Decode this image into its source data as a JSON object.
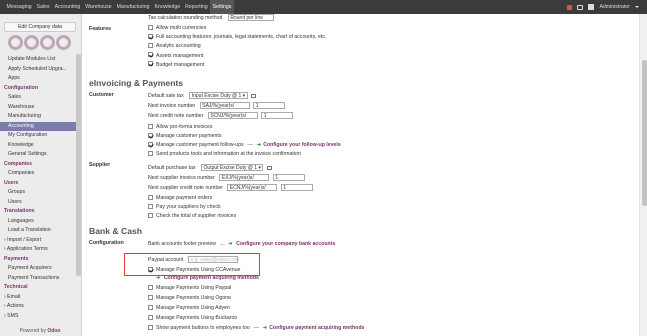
{
  "topbar": {
    "menu": [
      "Messaging",
      "Sales",
      "Accounting",
      "Warehouse",
      "Manufacturing",
      "Knowledge",
      "Reporting",
      "Settings"
    ],
    "active": "Settings",
    "user": "Administrator"
  },
  "sidebar": {
    "edit_company": "Edit Company data",
    "items": [
      {
        "label": "Update Modules List",
        "type": "item"
      },
      {
        "label": "Apply Scheduled Upgra...",
        "type": "item"
      },
      {
        "label": "Apps",
        "type": "item"
      },
      {
        "label": "Configuration",
        "type": "head"
      },
      {
        "label": "Sales",
        "type": "item"
      },
      {
        "label": "Warehouse",
        "type": "item"
      },
      {
        "label": "Manufacturing",
        "type": "item"
      },
      {
        "label": "Accounting",
        "type": "item",
        "active": true
      },
      {
        "label": "My Configuration",
        "type": "item"
      },
      {
        "label": "Knowledge",
        "type": "item"
      },
      {
        "label": "General Settings",
        "type": "item"
      },
      {
        "label": "Companies",
        "type": "head"
      },
      {
        "label": "Companies",
        "type": "item"
      },
      {
        "label": "Users",
        "type": "head"
      },
      {
        "label": "Groups",
        "type": "item"
      },
      {
        "label": "Users",
        "type": "item"
      },
      {
        "label": "Translations",
        "type": "head"
      },
      {
        "label": "Languages",
        "type": "item"
      },
      {
        "label": "Load a Translation",
        "type": "item"
      },
      {
        "label": "› Import / Export",
        "type": "sub"
      },
      {
        "label": "› Application Terms",
        "type": "sub"
      },
      {
        "label": "Payments",
        "type": "head"
      },
      {
        "label": "Payment Acquirers",
        "type": "item"
      },
      {
        "label": "Payment Transactions",
        "type": "item"
      },
      {
        "label": "Technical",
        "type": "head"
      },
      {
        "label": "› Email",
        "type": "sub"
      },
      {
        "label": "› Actions",
        "type": "sub"
      },
      {
        "label": "› SMS",
        "type": "sub"
      }
    ],
    "footer_prefix": "Powered by ",
    "footer_brand": "Odoo"
  },
  "main": {
    "rounding_label": "Tax calculation rounding method",
    "rounding_value": "Round per line",
    "features_label": "Features",
    "features": [
      {
        "label": "Allow multi currencies",
        "checked": false
      },
      {
        "label": "Full accounting features: journals, legal statements, chart of accounts, etc.",
        "checked": true
      },
      {
        "label": "Analytic accounting",
        "checked": false
      },
      {
        "label": "Assets management",
        "checked": true
      },
      {
        "label": "Budget management",
        "checked": true
      }
    ],
    "einvoicing_title": "eInvoicing & Payments",
    "customer_label": "Customer",
    "default_sale_tax_label": "Default sale tax",
    "default_sale_tax_value": "Input Excise Duty @ 1",
    "next_invoice_label": "Next invoice number",
    "next_invoice_prefix": "SAJ/%(year)s/",
    "next_invoice_num": "1",
    "next_credit_label": "Next credit note number",
    "next_credit_prefix": "SCNJ/%(year)s/",
    "next_credit_num": "1",
    "customer_options": [
      {
        "label": "Allow pro-forma invoices",
        "checked": false
      },
      {
        "label": "Manage customer payments",
        "checked": true
      },
      {
        "label": "Manage customer payment follow-ups",
        "checked": true,
        "link": "Configure your follow-up levels"
      },
      {
        "label": "Send products tools and information at the invoice confirmation",
        "checked": false
      }
    ],
    "supplier_label": "Supplier",
    "default_purchase_tax_label": "Default purchase tax",
    "default_purchase_tax_value": "Output Excise Duty @ 1",
    "next_supplier_invoice_label": "Next supplier invoice number",
    "next_supplier_invoice_prefix": "EXJ/%(year)s/",
    "next_supplier_invoice_num": "1",
    "next_supplier_credit_label": "Next supplier credit note number",
    "next_supplier_credit_prefix": "ECNJ/%(year)s/",
    "next_supplier_credit_num": "1",
    "supplier_options": [
      {
        "label": "Manage payment orders",
        "checked": false
      },
      {
        "label": "Pay your suppliers by check",
        "checked": false
      },
      {
        "label": "Check the total of supplier invoices",
        "checked": false
      }
    ],
    "bank_title": "Bank & Cash",
    "configuration_label": "Configuration",
    "bank_footer_label": "Bank accounts footer preview",
    "bank_footer_dots": "...",
    "bank_footer_link": "Configure your company bank accounts",
    "paypal_label": "Paypal account",
    "paypal_placeholder": "e.g. sales@odoo.com",
    "ccavenue_label": "Manage Payments Using CCAvenue",
    "ccavenue_checked": true,
    "acquiring_link": "Configure payment acquiring methods",
    "payment_options": [
      {
        "label": "Manage Payments Using Paypal",
        "checked": false
      },
      {
        "label": "Manage Payments Using Ogone",
        "checked": false
      },
      {
        "label": "Manage Payments Using Adyen",
        "checked": false
      },
      {
        "label": "Manage Payments Using Buckaroo",
        "checked": false
      },
      {
        "label": "Show payment buttons to employees too",
        "checked": false,
        "link": "Configure payment acquiring methods"
      }
    ],
    "colors": {
      "brand": "#7c3468",
      "active_item": "#7c7bad",
      "highlight": "#e03a3a",
      "topbar": "#3b3b3b"
    }
  }
}
